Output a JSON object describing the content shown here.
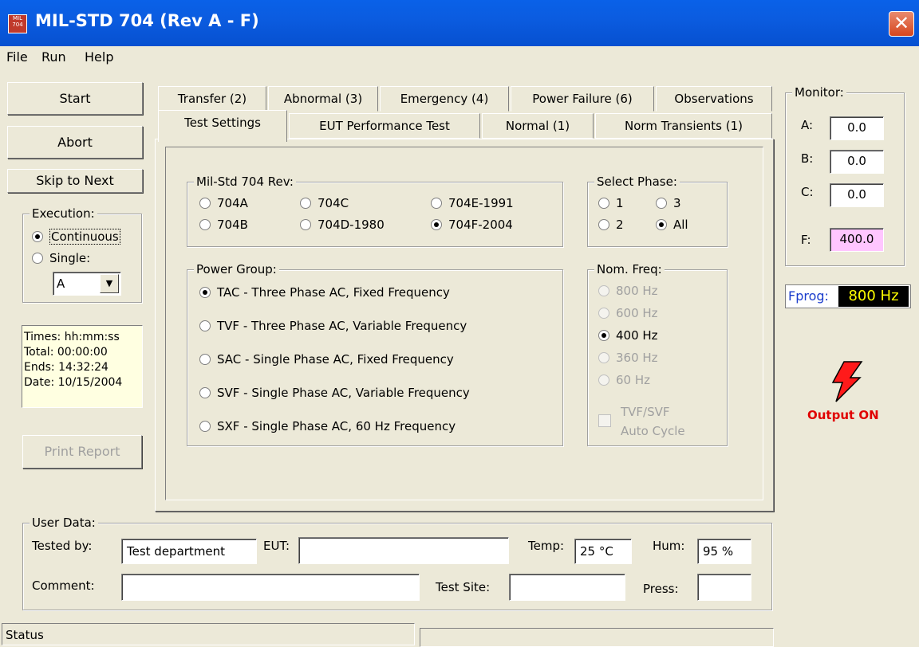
{
  "window": {
    "title": "MIL-STD 704 (Rev A - F)",
    "icon_text": "MIL 704",
    "close_label": "✕"
  },
  "menu": {
    "file": "File",
    "run": "Run",
    "help": "Help"
  },
  "left": {
    "start": "Start",
    "abort": "Abort",
    "skip": "Skip to Next",
    "execution_title": "Execution:",
    "continuous": "Continuous",
    "single": "Single:",
    "single_select": "A",
    "times": {
      "header": "Times: hh:mm:ss",
      "total": "Total:   00:00:00",
      "ends": "Ends:   14:32:24",
      "date": "Date: 10/15/2004"
    },
    "print": "Print Report"
  },
  "tabs": {
    "row1": [
      "Transfer (2)",
      "Abnormal (3)",
      "Emergency (4)",
      "Power Failure (6)",
      "Observations"
    ],
    "row2": [
      "Test Settings",
      "EUT Performance Test",
      "Normal (1)",
      "Norm Transients (1)"
    ]
  },
  "rev": {
    "title": "Mil-Std 704 Rev:",
    "opts": [
      "704A",
      "704C",
      "704E-1991",
      "704B",
      "704D-1980",
      "704F-2004"
    ]
  },
  "phase": {
    "title": "Select Phase:",
    "opts": [
      "1",
      "3",
      "2",
      "All"
    ]
  },
  "power": {
    "title": "Power Group:",
    "opts": [
      "TAC - Three Phase AC, Fixed Frequency",
      "TVF - Three Phase AC, Variable Frequency",
      "SAC - Single Phase AC, Fixed Frequency",
      "SVF - Single Phase AC, Variable Frequency",
      "SXF - Single Phase AC, 60 Hz Frequency"
    ]
  },
  "freq": {
    "title": "Nom. Freq:",
    "opts": [
      "800 Hz",
      "600 Hz",
      "400 Hz",
      "360 Hz",
      "60 Hz"
    ],
    "auto1": "TVF/SVF",
    "auto2": "Auto Cycle"
  },
  "monitor": {
    "title": "Monitor:",
    "a_label": "A:",
    "a": "0.0",
    "b_label": "B:",
    "b": "0.0",
    "c_label": "C:",
    "c": "0.0",
    "f_label": "F:",
    "f": "400.0"
  },
  "fprog": {
    "label": "Fprog:",
    "value": "800 Hz"
  },
  "output": {
    "label": "Output ON"
  },
  "user": {
    "title": "User Data:",
    "tested_label": "Tested by:",
    "tested": "Test department",
    "eut_label": "EUT:",
    "eut": "",
    "temp_label": "Temp:",
    "temp": "25 °C",
    "hum_label": "Hum:",
    "hum": "95 %",
    "comment_label": "Comment:",
    "comment": "",
    "site_label": "Test Site:",
    "site": "",
    "press_label": "Press:",
    "press": ""
  },
  "status": {
    "text": "Status"
  },
  "colors": {
    "title_bar": "#0a61e8",
    "f_field": "#ffc6ff",
    "fprog_bg": "#000000",
    "fprog_fg": "#ffff00",
    "output": "#e00000",
    "times_bg": "#ffffe1"
  }
}
